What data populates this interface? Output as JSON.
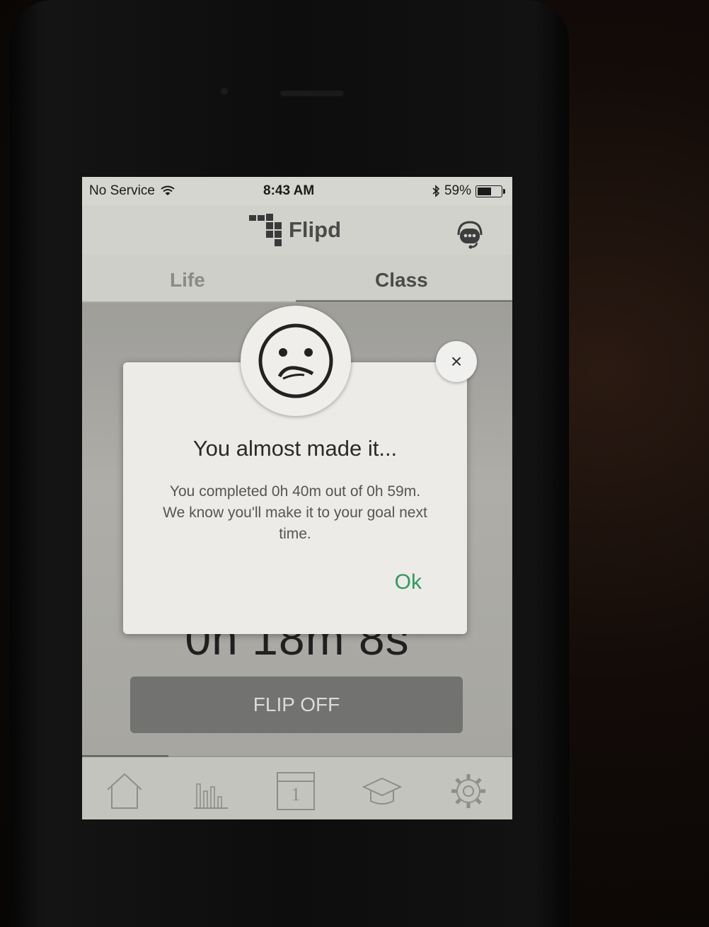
{
  "status_bar": {
    "carrier": "No Service",
    "time": "8:43 AM",
    "battery_percent": "59%",
    "battery_level": 0.59,
    "wifi_icon": "wifi-icon",
    "bluetooth_icon": "bluetooth-icon"
  },
  "header": {
    "app_name": "Flipd",
    "logo_icon": "flipd-logo-icon",
    "support_icon": "headset-support-icon"
  },
  "tabs": [
    {
      "label": "Life",
      "active": false
    },
    {
      "label": "Class",
      "active": true
    }
  ],
  "main": {
    "timer_text": "0h 18m 8s",
    "flip_button_label": "FLIP OFF"
  },
  "dialog": {
    "face_icon": "sad-face-icon",
    "title": "You almost made it...",
    "message": "You completed 0h 40m out of 0h 59m. We know you'll make it to your goal next time.",
    "ok_label": "Ok",
    "close_label": "×"
  },
  "tabbar": {
    "items": [
      {
        "icon": "home-icon"
      },
      {
        "icon": "stats-bar-chart-icon"
      },
      {
        "icon": "calendar-icon",
        "label": "1"
      },
      {
        "icon": "graduation-cap-icon"
      },
      {
        "icon": "gear-icon"
      }
    ]
  },
  "colors": {
    "accent_green": "#2e9a5a",
    "flip_button": "#7a7a77"
  }
}
